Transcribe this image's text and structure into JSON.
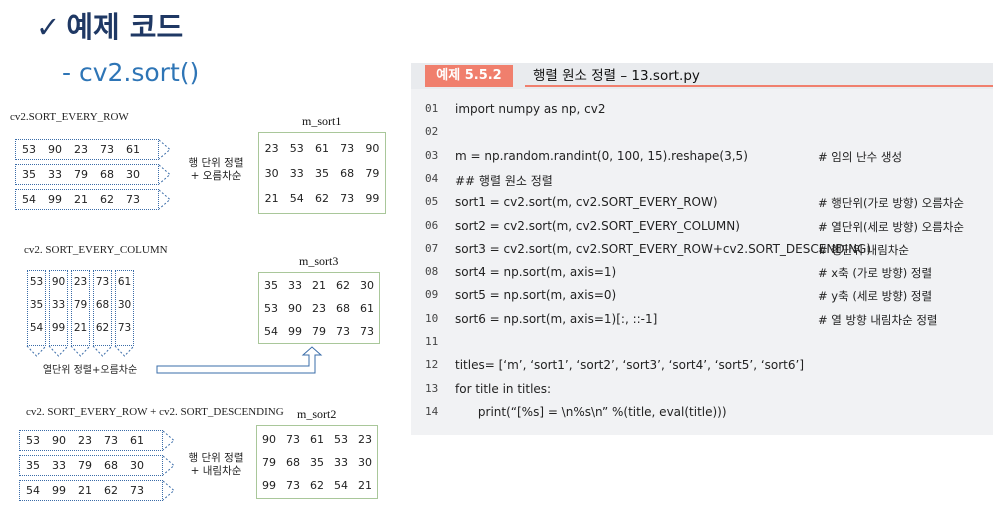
{
  "heading": {
    "check": "✓",
    "text": "예제 코드"
  },
  "subheading": "- cv2.sort()",
  "diagrams": {
    "row": {
      "label": "cv2.SORT_EVERY_ROW",
      "rows": [
        [
          "53",
          "90",
          "23",
          "73",
          "61"
        ],
        [
          "35",
          "33",
          "79",
          "68",
          "30"
        ],
        [
          "54",
          "99",
          "21",
          "62",
          "73"
        ]
      ],
      "note": [
        "행 단위 정렬",
        "+ 오름차순"
      ],
      "result_label": "m_sort1",
      "result": [
        [
          "23",
          "53",
          "61",
          "73",
          "90"
        ],
        [
          "30",
          "33",
          "35",
          "68",
          "79"
        ],
        [
          "21",
          "54",
          "62",
          "73",
          "99"
        ]
      ]
    },
    "col": {
      "label": "cv2. SORT_EVERY_COLUMN",
      "rows": [
        [
          "53",
          "90",
          "23",
          "73",
          "61"
        ],
        [
          "35",
          "33",
          "79",
          "68",
          "30"
        ],
        [
          "54",
          "99",
          "21",
          "62",
          "73"
        ]
      ],
      "note": "열단위 정렬+오름차순",
      "result_label": "m_sort3",
      "result": [
        [
          "35",
          "33",
          "21",
          "62",
          "30"
        ],
        [
          "53",
          "90",
          "23",
          "68",
          "61"
        ],
        [
          "54",
          "99",
          "79",
          "73",
          "73"
        ]
      ]
    },
    "desc": {
      "label": "cv2. SORT_EVERY_ROW + cv2. SORT_DESCENDING",
      "rows": [
        [
          "53",
          "90",
          "23",
          "73",
          "61"
        ],
        [
          "35",
          "33",
          "79",
          "68",
          "30"
        ],
        [
          "54",
          "99",
          "21",
          "62",
          "73"
        ]
      ],
      "note": [
        "행 단위 정렬",
        "+ 내림차순"
      ],
      "result_label": "m_sort2",
      "result": [
        [
          "90",
          "73",
          "61",
          "53",
          "23"
        ],
        [
          "79",
          "68",
          "35",
          "33",
          "30"
        ],
        [
          "99",
          "73",
          "62",
          "54",
          "21"
        ]
      ]
    }
  },
  "code": {
    "tag": "예제 5.5.2",
    "title": "행렬 원소 정렬 – 13.sort.py",
    "lines": [
      {
        "n": "01",
        "code": "import numpy as np, cv2",
        "comment": ""
      },
      {
        "n": "02",
        "code": "",
        "comment": ""
      },
      {
        "n": "03",
        "code": "m = np.random.randint(0, 100, 15).reshape(3,5)",
        "comment": "# 임의 난수 생성"
      },
      {
        "n": "04",
        "code": "## 행렬 원소 정렬",
        "comment": ""
      },
      {
        "n": "05",
        "code": "sort1 = cv2.sort(m, cv2.SORT_EVERY_ROW)",
        "comment": "# 행단위(가로 방향) 오름차순"
      },
      {
        "n": "06",
        "code": "sort2 = cv2.sort(m, cv2.SORT_EVERY_COLUMN)",
        "comment": "# 열단위(세로 방향) 오름차순"
      },
      {
        "n": "07",
        "code": "sort3 = cv2.sort(m, cv2.SORT_EVERY_ROW+cv2.SORT_DESCENDING)",
        "comment": "# 행단위 내림차순"
      },
      {
        "n": "08",
        "code": "sort4 = np.sort(m, axis=1)",
        "comment": "# x축 (가로 방향) 정렬"
      },
      {
        "n": "09",
        "code": "sort5 = np.sort(m, axis=0)",
        "comment": "# y축 (세로 방향) 정렬"
      },
      {
        "n": "10",
        "code": "sort6 = np.sort(m, axis=1)[:, ::-1]",
        "comment": "# 열 방향 내림차순 정렬"
      },
      {
        "n": "11",
        "code": "",
        "comment": ""
      },
      {
        "n": "12",
        "code": "titles= [‘m’, ‘sort1’, ‘sort2’, ‘sort3’, ‘sort4’, ‘sort5’, ‘sort6’]",
        "comment": ""
      },
      {
        "n": "13",
        "code": "for title in titles:",
        "comment": ""
      },
      {
        "n": "14",
        "code": "      print(“[%s] = \\n%s\\n” %(title, eval(title)))",
        "comment": ""
      }
    ]
  }
}
